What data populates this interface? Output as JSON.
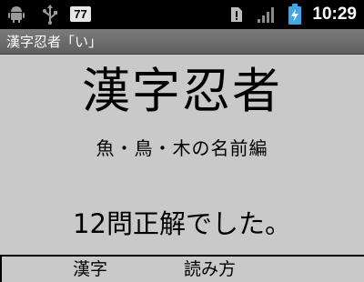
{
  "status_bar": {
    "icons": [
      "android-icon",
      "usb-icon",
      "notification-badge",
      "alert-icon",
      "signal-icon",
      "battery-charging-icon"
    ],
    "notification_count": "77",
    "time": "10:29"
  },
  "app": {
    "title": "漢字忍者「い」"
  },
  "main": {
    "heading": "漢字忍者",
    "subheading": "魚・鳥・木の名前編",
    "result_text": "12問正解でした。"
  },
  "table": {
    "headers": [
      "漢字",
      "読み方"
    ]
  }
}
